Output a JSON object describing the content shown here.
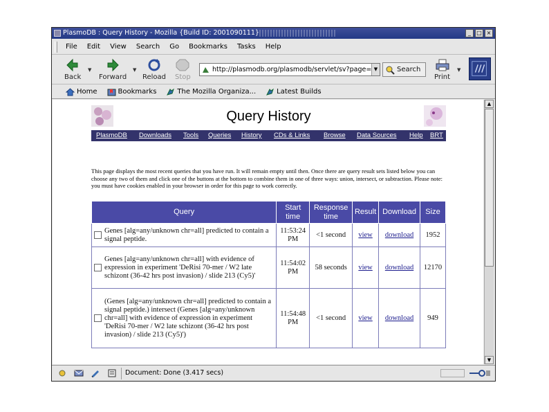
{
  "window": {
    "title": "PlasmoDB : Query History - Mozilla {Build ID: 2001090111}",
    "controls": [
      "_",
      "□",
      "×"
    ]
  },
  "menu": [
    "File",
    "Edit",
    "View",
    "Search",
    "Go",
    "Bookmarks",
    "Tasks",
    "Help"
  ],
  "toolbar": {
    "back": "Back",
    "forward": "Forward",
    "reload": "Reload",
    "stop": "Stop",
    "url": "http://plasmodb.org/plasmodb/servlet/sv?page=his",
    "search": "Search",
    "print": "Print"
  },
  "personal_toolbar": {
    "home": "Home",
    "bookmarks": "Bookmarks",
    "mozilla": "The Mozilla Organiza...",
    "latest": "Latest Builds"
  },
  "page": {
    "title": "Query History",
    "nav": [
      "PlasmoDB",
      "Downloads",
      "Tools",
      "Queries",
      "History",
      "CDs & Links",
      "Browse",
      "Data Sources",
      "Help",
      "BRT"
    ],
    "intro": "This page displays the most recent queries that you have run. It will remain empty until then. Once there are query result sets listed below you can choose any two of them and click one of the buttons at the bottom to combine them in one of three ways: union, intersect, or subtraction. Please note: you must have cookies enabled in your browser in order for this page to work correctly.",
    "table": {
      "headers": {
        "query": "Query",
        "start_time": "Start time",
        "response_time": "Response time",
        "result": "Result",
        "download": "Download",
        "size": "Size"
      },
      "rows": [
        {
          "query": "Genes [alg=any/unknown chr=all] predicted to contain a signal peptide.",
          "start_time": "11:53:24 PM",
          "response_time": "<1 second",
          "result": "view",
          "download": "download",
          "size": "1952"
        },
        {
          "query": "Genes [alg=any/unknown chr=all] with evidence of expression in experiment 'DeRisi 70-mer / W2 late schizont (36-42 hrs post invasion) / slide 213 (Cy5)'",
          "start_time": "11:54:02 PM",
          "response_time": "58 seconds",
          "result": "view",
          "download": "download",
          "size": "12170"
        },
        {
          "query": "(Genes [alg=any/unknown chr=all] predicted to contain a signal peptide.) intersect (Genes [alg=any/unknown chr=all] with evidence of expression in experiment 'DeRisi 70-mer / W2 late schizont (36-42 hrs post invasion) / slide 213 (Cy5)')",
          "start_time": "11:54:48 PM",
          "response_time": "<1 second",
          "result": "view",
          "download": "download",
          "size": "949"
        }
      ]
    }
  },
  "status": {
    "text": "Document: Done (3.417 secs)"
  }
}
